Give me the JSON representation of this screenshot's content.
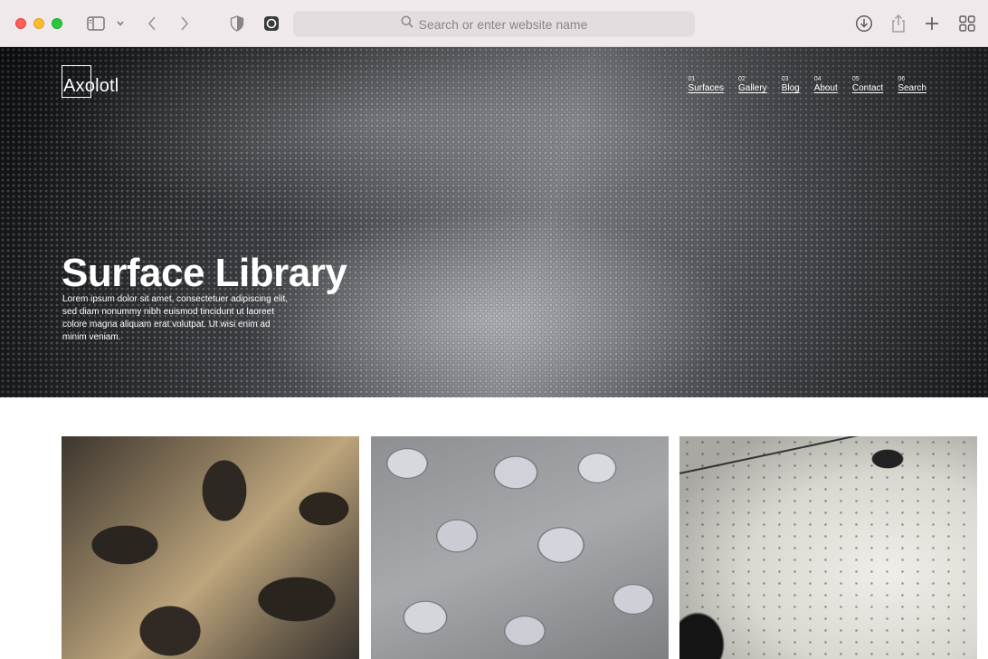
{
  "browser": {
    "address_placeholder": "Search or enter website name"
  },
  "site": {
    "logo": "Axolotl",
    "nav": [
      {
        "num": "01",
        "label": "Surfaces"
      },
      {
        "num": "02",
        "label": "Gallery"
      },
      {
        "num": "03",
        "label": "Blog"
      },
      {
        "num": "04",
        "label": "About"
      },
      {
        "num": "05",
        "label": "Contact"
      },
      {
        "num": "06",
        "label": "Search"
      }
    ],
    "hero": {
      "title": "Surface Library",
      "description": "Lorem ipsum dolor sit amet, consectetuer adipiscing elit, sed diam nonummy nibh euismod tincidunt ut laoreet colore magna aliquam erat volutpat. Ut wisi enim ad minim veniam."
    }
  },
  "colors": {
    "chrome_bg": "#f0e9ec",
    "address_bg": "#e4dde0",
    "hero_text": "#ffffff"
  }
}
